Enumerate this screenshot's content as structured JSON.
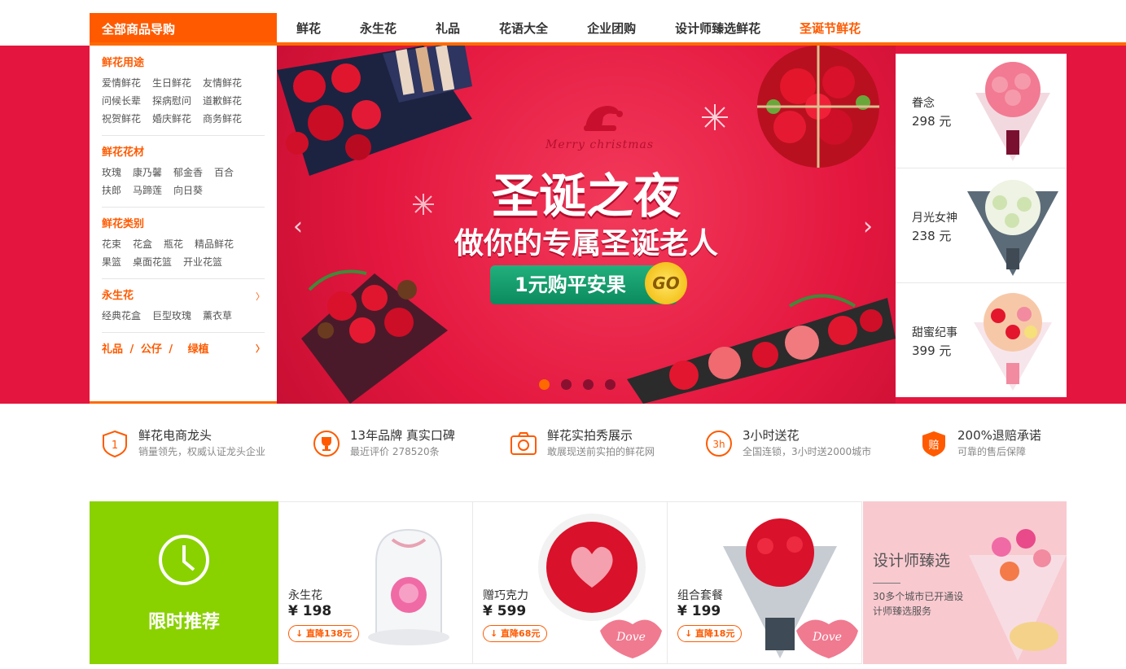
{
  "nav": {
    "category_button": "全部商品导购",
    "items": [
      "鲜花",
      "永生花",
      "礼品",
      "花语大全",
      "企业团购",
      "设计师臻选鲜花",
      "圣诞节鲜花"
    ]
  },
  "sidebar": {
    "sections": [
      {
        "title": "鲜花用途",
        "links": [
          "爱情鲜花",
          "生日鲜花",
          "友情鲜花",
          "问候长辈",
          "探病慰问",
          "道歉鲜花",
          "祝贺鲜花",
          "婚庆鲜花",
          "商务鲜花"
        ]
      },
      {
        "title": "鲜花花材",
        "links": [
          "玫瑰",
          "康乃馨",
          "郁金香",
          "百合",
          "扶郎",
          "马蹄莲",
          "向日葵"
        ]
      },
      {
        "title": "鲜花类别",
        "links": [
          "花束",
          "花盒",
          "瓶花",
          "精品鲜花",
          "果篮",
          "桌面花篮",
          "开业花篮"
        ]
      },
      {
        "title": "永生花",
        "links": [
          "经典花盒",
          "巨型玫瑰",
          "薰衣草"
        ],
        "arrow": "〉"
      }
    ],
    "last_row": {
      "a": "礼品",
      "sep1": "/",
      "b": "公仔",
      "sep2": "/",
      "c": "绿植",
      "arrow": "〉"
    }
  },
  "banner": {
    "script_text": "Merry christmas",
    "title": "圣诞之夜",
    "subtitle": "做你的专属圣诞老人",
    "pill": "1元购平安果",
    "go": "GO",
    "prev": "‹",
    "next": "›"
  },
  "right_products": [
    {
      "name": "眷念",
      "price": "298 元"
    },
    {
      "name": "月光女神",
      "price": "238 元"
    },
    {
      "name": "甜蜜纪事",
      "price": "399 元"
    }
  ],
  "features": [
    {
      "title": "鲜花电商龙头",
      "sub": "销量领先，权威认证龙头企业",
      "icon": "shield-1-icon"
    },
    {
      "title": "13年品牌 真实口碑",
      "sub": "最近评价 278520条",
      "icon": "trophy-icon"
    },
    {
      "title": "鲜花实拍秀展示",
      "sub": "敢展现送前实拍的鲜花网",
      "icon": "camera-icon"
    },
    {
      "title": "3小时送花",
      "sub": "全国连锁，3小时送2000城市",
      "icon": "3h-clock-icon"
    },
    {
      "title": "200%退赔承诺",
      "sub": "可靠的售后保障",
      "icon": "compensation-shield-icon"
    }
  ],
  "limited": {
    "label": "限时推荐"
  },
  "cards": [
    {
      "name": "永生花",
      "price": "¥ 198",
      "drop": "↓ 直降138元"
    },
    {
      "name": "赠巧克力",
      "price": "¥ 599",
      "drop": "↓ 直降68元"
    },
    {
      "name": "组合套餐",
      "price": "¥ 199",
      "drop": "↓ 直降18元"
    }
  ],
  "designer": {
    "title": "设计师臻选",
    "sub": "30多个城市已开通设计师臻选服务"
  },
  "colors": {
    "accent": "#ff5a00",
    "banner": "#e4163f",
    "limited": "#8ad100",
    "designer_bg": "#f9c9d0"
  }
}
